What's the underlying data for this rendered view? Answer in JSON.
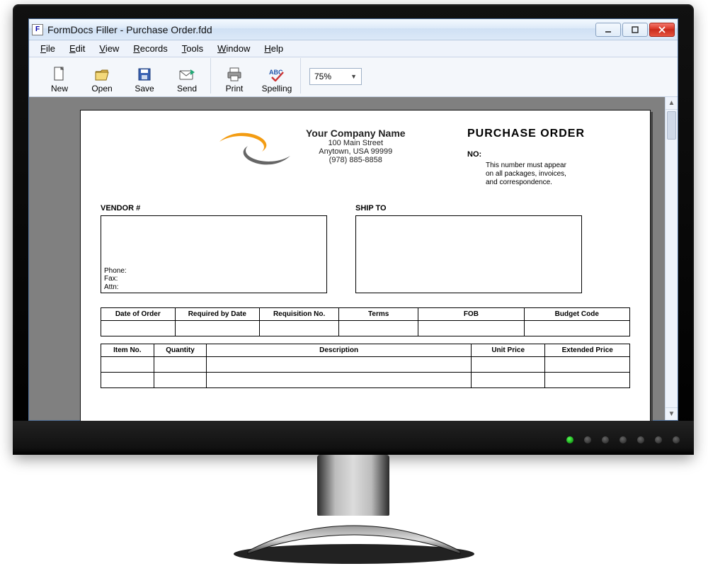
{
  "window": {
    "title": "FormDocs Filler - Purchase Order.fdd"
  },
  "menu": {
    "file": "File",
    "edit": "Edit",
    "view": "View",
    "records": "Records",
    "tools": "Tools",
    "windowm": "Window",
    "help": "Help"
  },
  "toolbar": {
    "new": "New",
    "open": "Open",
    "save": "Save",
    "send": "Send",
    "print": "Print",
    "spelling": "Spelling",
    "zoom": "75%"
  },
  "form": {
    "company_name": "Your Company Name",
    "company_addr1": "100 Main Street",
    "company_addr2": "Anytown, USA 99999",
    "company_phone": "(978) 885-8858",
    "po_title": "PURCHASE ORDER",
    "po_no_label": "NO:",
    "po_note1": "This number must appear",
    "po_note2": "on all packages, invoices,",
    "po_note3": "and correspondence.",
    "vendor_label": "VENDOR #",
    "shipto_label": "SHIP TO",
    "phone_label": "Phone:",
    "fax_label": "Fax:",
    "attn_label": "Attn:",
    "meta_headers": {
      "date": "Date of Order",
      "required": "Required by Date",
      "req_no": "Requisition No.",
      "terms": "Terms",
      "fob": "FOB",
      "budget": "Budget Code"
    },
    "item_headers": {
      "item_no": "Item No.",
      "qty": "Quantity",
      "desc": "Description",
      "unit": "Unit Price",
      "ext": "Extended Price"
    }
  }
}
